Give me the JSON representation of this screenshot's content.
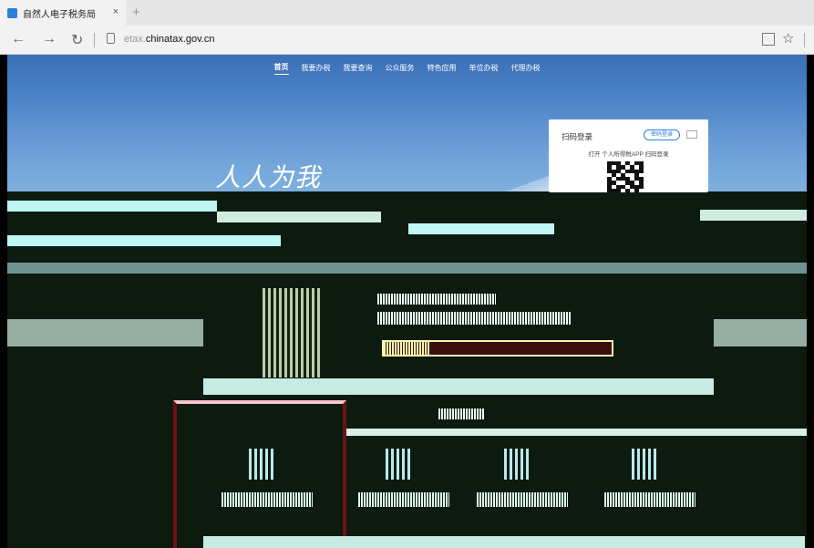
{
  "browser": {
    "tab_title": "自然人电子税务局",
    "tab_close": "×",
    "new_tab": "+",
    "back": "←",
    "forward": "→",
    "refresh": "↻",
    "url_prefix": "etax.",
    "url_domain": "chinatax.gov.cn",
    "star": "☆"
  },
  "nav": {
    "items": [
      "首页",
      "我要办税",
      "我要查询",
      "公众服务",
      "特色应用",
      "单位办税",
      "代理办税"
    ]
  },
  "hero": {
    "slogan": "人人为我"
  },
  "login": {
    "title": "扫码登录",
    "switch_label": "密码登录",
    "hint": "打开 个人所得税APP 扫码登录"
  },
  "colors": {
    "hero_blue": "#4f86c9",
    "dark_band": "#0c1a10",
    "accent": "#2f7fd8"
  }
}
